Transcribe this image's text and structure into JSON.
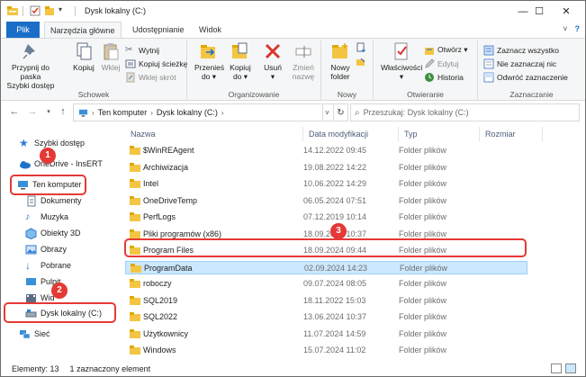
{
  "window": {
    "title": "Dysk lokalny (C:)",
    "controls": {
      "minimize": "—",
      "maximize": "☐",
      "close": "✕"
    }
  },
  "ribbon_tabs": [
    "Plik",
    "Narzędzia główne",
    "Udostępnianie",
    "Widok"
  ],
  "ribbon": {
    "schowek": {
      "label": "Schowek",
      "pin": "Przypnij do paska\nSzybki dostęp",
      "copy": "Kopiuj",
      "paste": "Wklej",
      "cut": "Wytnij",
      "copy_path": "Kopiuj ścieżkę",
      "paste_shortcut": "Wklej skrót"
    },
    "organize": {
      "label": "Organizowanie",
      "move_to": "Przenieś\ndo ▾",
      "copy_to": "Kopiuj\ndo ▾",
      "delete": "Usuń\n▾",
      "rename": "Zmień\nnazwę"
    },
    "new": {
      "label": "Nowy",
      "new_folder": "Nowy\nfolder"
    },
    "open": {
      "label": "Otwieranie",
      "properties": "Właściwości\n▾",
      "open": "Otwórz ▾",
      "edit": "Edytuj",
      "history": "Historia"
    },
    "select": {
      "label": "Zaznaczanie",
      "select_all": "Zaznacz wszystko",
      "select_none": "Nie zaznaczaj nic",
      "invert": "Odwróć zaznaczenie"
    }
  },
  "address": {
    "crumbs": [
      "Ten komputer",
      "Dysk lokalny (C:)"
    ],
    "search_placeholder": "Przeszukaj: Dysk lokalny (C:)"
  },
  "nav": {
    "quick_access": "Szybki dostęp",
    "onedrive": "OneDrive - InsERT",
    "this_pc": "Ten komputer",
    "documents": "Dokumenty",
    "music": "Muzyka",
    "objects3d": "Obiekty 3D",
    "pictures": "Obrazy",
    "downloads": "Pobrane",
    "desktop": "Pulpit",
    "videos": "Wid",
    "local_disk": "Dysk lokalny (C:)",
    "network": "Sieć"
  },
  "columns": {
    "name": "Nazwa",
    "date": "Data modyfikacji",
    "type": "Typ",
    "size": "Rozmiar"
  },
  "files": [
    {
      "name": "$WinREAgent",
      "date": "14.12.2022 09:45",
      "type": "Folder plików"
    },
    {
      "name": "Archiwizacja",
      "date": "19.08.2022 14:22",
      "type": "Folder plików"
    },
    {
      "name": "Intel",
      "date": "10.06.2022 14:29",
      "type": "Folder plików"
    },
    {
      "name": "OneDriveTemp",
      "date": "06.05.2024 07:51",
      "type": "Folder plików"
    },
    {
      "name": "PerfLogs",
      "date": "07.12.2019 10:14",
      "type": "Folder plików"
    },
    {
      "name": "Pliki programów (x86)",
      "date": "18.09.2024 10:37",
      "type": "Folder plików"
    },
    {
      "name": "Program Files",
      "date": "18.09.2024 09:44",
      "type": "Folder plików"
    },
    {
      "name": "ProgramData",
      "date": "02.09.2024 14:23",
      "type": "Folder plików"
    },
    {
      "name": "roboczy",
      "date": "09.07.2024 08:05",
      "type": "Folder plików"
    },
    {
      "name": "SQL2019",
      "date": "18.11.2022 15:03",
      "type": "Folder plików"
    },
    {
      "name": "SQL2022",
      "date": "13.06.2024 10:37",
      "type": "Folder plików"
    },
    {
      "name": "Użytkownicy",
      "date": "11.07.2024 14:59",
      "type": "Folder plików"
    },
    {
      "name": "Windows",
      "date": "15.07.2024 11:02",
      "type": "Folder plików"
    }
  ],
  "selected_index": 7,
  "status": {
    "count": "Elementy: 13",
    "selected": "1 zaznaczony element"
  },
  "annotations": [
    "1",
    "2",
    "3"
  ],
  "colors": {
    "accent": "#1a6ec7",
    "highlight": "#e53935",
    "folder": "#f4c542",
    "selection": "#cce8ff"
  }
}
